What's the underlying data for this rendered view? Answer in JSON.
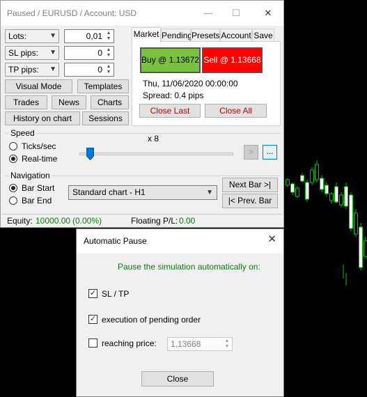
{
  "main_window": {
    "title": "Paused / EURUSD / Account: USD",
    "controls": {
      "minimize": "—",
      "maximize": "☐",
      "close": "✕"
    },
    "fields": [
      {
        "label": "Lots:",
        "value": "0,01"
      },
      {
        "label": "SL pips:",
        "value": "0"
      },
      {
        "label": "TP pips:",
        "value": "0"
      }
    ],
    "buttons": {
      "visual_mode": "Visual Mode",
      "templates": "Templates",
      "trades": "Trades",
      "news": "News",
      "charts": "Charts",
      "history_on_chart": "History on chart",
      "sessions": "Sessions"
    },
    "tabs": [
      "Market",
      "Pending",
      "Presets",
      "Account",
      "Save"
    ],
    "active_tab": "Market",
    "market": {
      "buy_label": "Buy @ 1.13672",
      "sell_label": "Sell @ 1.13668",
      "datetime": "Thu, 11/06/2020  00:00:00",
      "spread": "Spread: 0.4 pips",
      "close_last": "Close Last",
      "close_all": "Close All"
    },
    "speed": {
      "group_label": "Speed",
      "multiplier": "x 8",
      "options": [
        "Ticks/sec",
        "Real-time"
      ],
      "selected": "Real-time",
      "slider_level": 0.07,
      "step_button": ">",
      "more_button": "..."
    },
    "navigation": {
      "group_label": "Navigation",
      "options": [
        "Bar Start",
        "Bar End"
      ],
      "selected": "Bar Start",
      "chart_select": "Standard chart - H1",
      "next_bar": "Next Bar >|",
      "prev_bar": "|< Prev. Bar"
    },
    "status": {
      "equity_label": "Equity:",
      "equity_value": "10000.00",
      "equity_pct": "(0.00%)",
      "floating_label": "Floating P/L:",
      "floating_value": "0.00"
    }
  },
  "dialog": {
    "title": "Automatic Pause",
    "close_icon": "✕",
    "heading": "Pause the simulation automatically on:",
    "options": [
      {
        "label": "SL / TP",
        "checked": true
      },
      {
        "label": "execution of pending order",
        "checked": true
      },
      {
        "label": "reaching price:",
        "checked": false
      }
    ],
    "price_value": "1,13668",
    "close_button": "Close"
  },
  "colors": {
    "buy": "#7ac142",
    "sell": "#ff0000",
    "green_text": "#0a7a0a",
    "close_red": "#c00000",
    "candle_bull": "#00c800",
    "candle_bear": "#ffffff"
  }
}
